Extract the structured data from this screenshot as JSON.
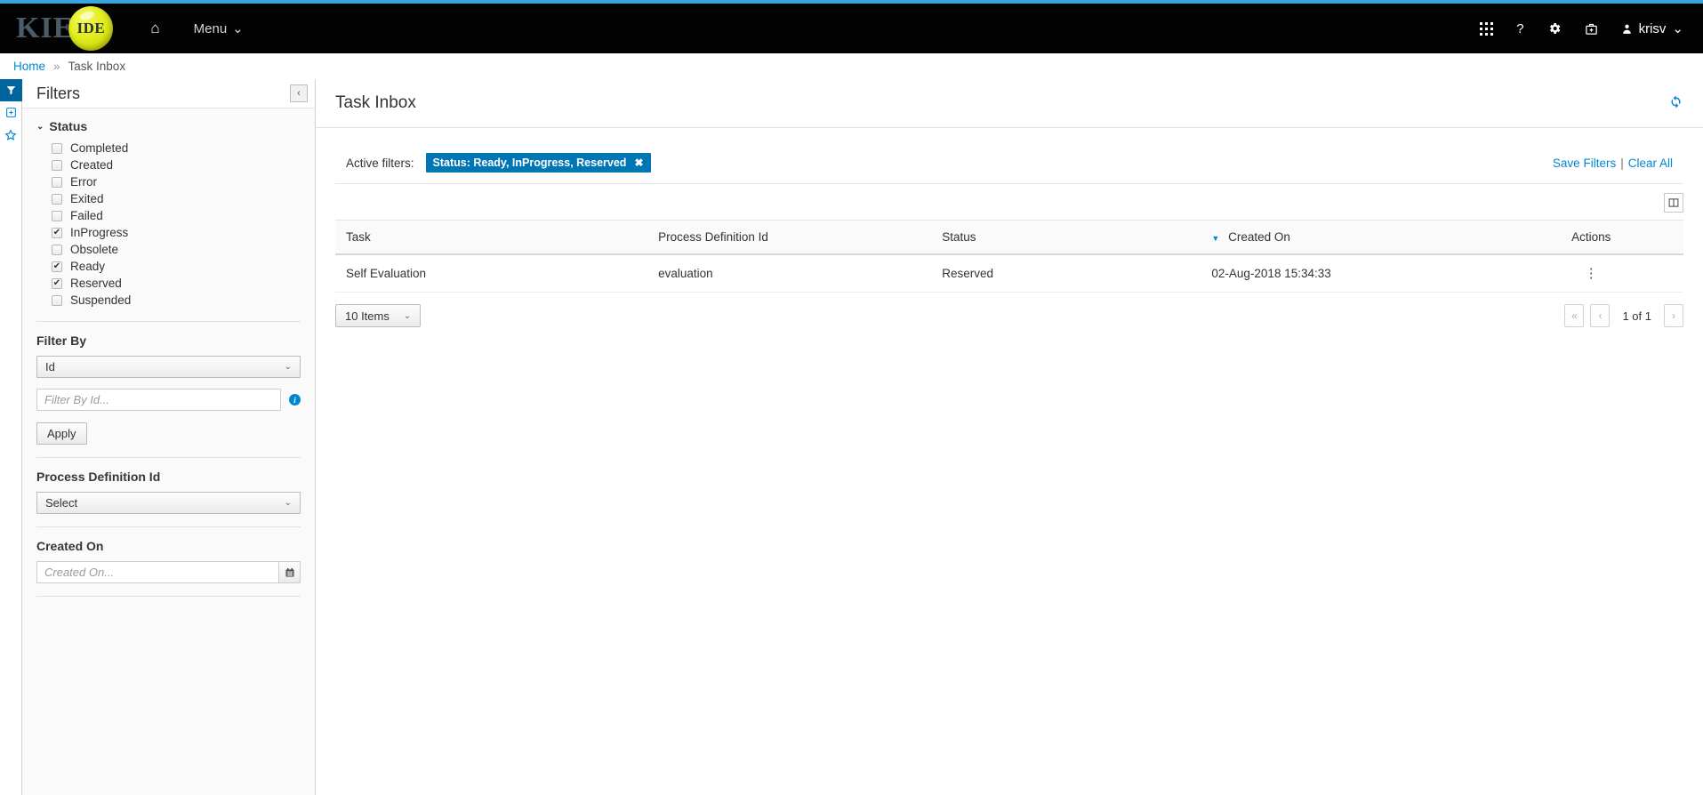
{
  "masthead": {
    "brand_text": "KIE",
    "brand_orb": "IDE",
    "home_icon": "home-icon",
    "menu_label": "Menu",
    "menu_caret": "⌄",
    "icons": {
      "grid": "grid-icon",
      "help": "?",
      "gear": "gear-icon",
      "suitcase": "suitcase-icon",
      "user": "user-icon"
    },
    "user_name": "krisv",
    "user_caret": "⌄",
    "accent_color": "#39a5dc",
    "background_color": "#030303"
  },
  "breadcrumb": {
    "home": "Home",
    "separator": "»",
    "current": "Task Inbox",
    "link_color": "#0088ce"
  },
  "rail": {
    "items": [
      {
        "name": "filter-icon",
        "glyph": "▼",
        "active": true
      },
      {
        "name": "plus-square-icon",
        "glyph": "⊞",
        "active": false
      },
      {
        "name": "star-icon",
        "glyph": "☆",
        "active": false
      }
    ],
    "active_bg": "#00659c",
    "icon_color": "#0088ce"
  },
  "filters_panel": {
    "title": "Filters",
    "collapse_glyph": "‹",
    "status": {
      "title": "Status",
      "caret": "⌄",
      "items": [
        {
          "label": "Completed",
          "checked": false
        },
        {
          "label": "Created",
          "checked": false
        },
        {
          "label": "Error",
          "checked": false
        },
        {
          "label": "Exited",
          "checked": false
        },
        {
          "label": "Failed",
          "checked": false
        },
        {
          "label": "InProgress",
          "checked": true
        },
        {
          "label": "Obsolete",
          "checked": false
        },
        {
          "label": "Ready",
          "checked": true
        },
        {
          "label": "Reserved",
          "checked": true
        },
        {
          "label": "Suspended",
          "checked": false
        }
      ],
      "check_glyph": "✔"
    },
    "filter_by": {
      "label": "Filter By",
      "select_value": "Id",
      "select_caret": "⌄",
      "input_placeholder": "Filter By Id...",
      "input_value": "",
      "info_glyph": "i",
      "apply_label": "Apply"
    },
    "process_definition": {
      "label": "Process Definition Id",
      "select_value": "Select",
      "select_caret": "⌄"
    },
    "created_on": {
      "label": "Created On",
      "input_placeholder": "Created On...",
      "input_value": "",
      "calendar_icon": "calendar-icon"
    }
  },
  "main": {
    "title": "Task Inbox",
    "refresh_icon": "refresh-icon",
    "active_filters_label": "Active filters:",
    "chips": [
      {
        "text": "Status: Ready, InProgress, Reserved",
        "close_glyph": "✖"
      }
    ],
    "chip_color": "#0076b5",
    "save_filters_label": "Save Filters",
    "pipe": "|",
    "clear_all_label": "Clear All",
    "column_toggle_icon": "columns-icon",
    "table": {
      "columns": [
        {
          "label": "Task",
          "sorted": false
        },
        {
          "label": "Process Definition Id",
          "sorted": false
        },
        {
          "label": "Status",
          "sorted": false
        },
        {
          "label": "Created On",
          "sorted": true,
          "sort_caret": "▼"
        },
        {
          "label": "Actions",
          "sorted": false
        }
      ],
      "rows": [
        {
          "task": "Self Evaluation",
          "process_definition_id": "evaluation",
          "status": "Reserved",
          "created_on": "02-Aug-2018 15:34:33",
          "actions_glyph": "⋮"
        }
      ]
    },
    "pagination": {
      "page_size_label": "10 Items",
      "page_size_caret": "⌄",
      "first_glyph": "«",
      "prev_glyph": "‹",
      "page_label": "1 of 1",
      "next_glyph": "›"
    }
  }
}
